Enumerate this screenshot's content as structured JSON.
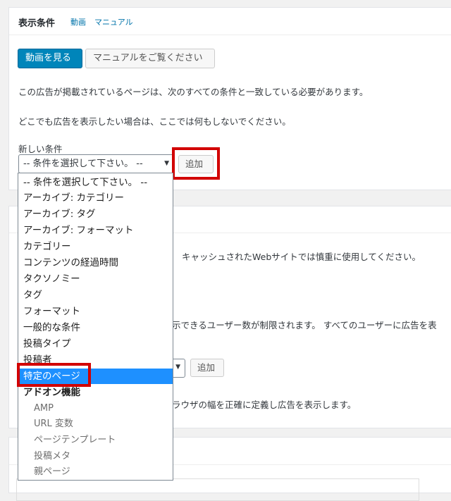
{
  "panel1": {
    "title": "表示条件",
    "link_video": "動画",
    "link_manual": "マニュアル",
    "btn_video": "動画を見る",
    "btn_manual": "マニュアルをご覧ください",
    "desc1": "この広告が掲載されているページは、次のすべての条件と一致している必要があります。",
    "desc2": "どこでも広告を表示したい場合は、ここでは何もしないでください。",
    "new_condition_label": "新しい条件",
    "select_value": "-- 条件を選択して下さい。 --",
    "add_button": "追加"
  },
  "panel2": {
    "text1": "キャッシュされたWebサイトでは慎重に使用してください。",
    "text2": "示できるユーザー数が制限されます。 すべてのユーザーに広告を表",
    "add_button": "追加",
    "text3": "ラウザの幅を正確に定義し広告を表示します。"
  },
  "dropdown": {
    "options": [
      "-- 条件を選択して下さい。 --",
      "アーカイブ: カテゴリー",
      "アーカイブ: タグ",
      "アーカイブ: フォーマット",
      "カテゴリー",
      "コンテンツの経過時間",
      "タクソノミー",
      "タグ",
      "フォーマット",
      "一般的な条件",
      "投稿タイプ",
      "投稿者",
      "特定のページ"
    ],
    "group_label": "アドオン機能",
    "group_options": [
      "AMP",
      "URL 変数",
      "ページテンプレート",
      "投稿メタ",
      "親ページ"
    ],
    "highlighted": "特定のページ"
  },
  "colors": {
    "primary": "#0085ba",
    "highlight": "#1e90ff",
    "annotation_red": "#d20000"
  }
}
